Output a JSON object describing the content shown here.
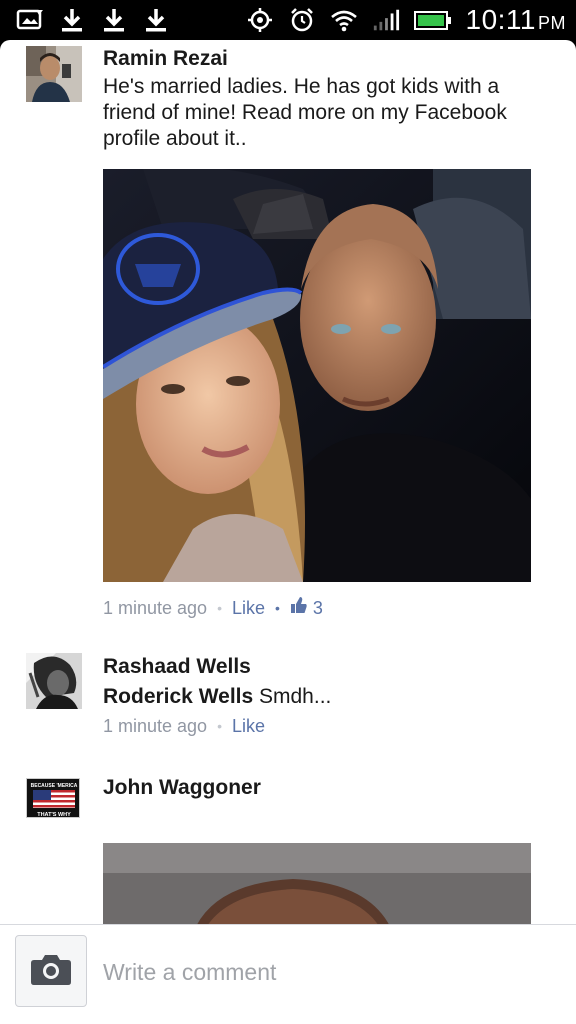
{
  "status_bar": {
    "time": "10:11",
    "ampm": "PM",
    "left_icons": [
      "photo-sync-icon",
      "download-icon",
      "download-icon",
      "download-icon"
    ],
    "right_icons": [
      "gps-icon",
      "alarm-icon",
      "wifi-icon",
      "signal-icon",
      "battery-icon"
    ]
  },
  "comments": [
    {
      "author": "Ramin Rezai",
      "text": "He's married ladies. He has got kids with a friend of mine! Read more on my Facebook profile about it..",
      "time": "1 minute ago",
      "like_label": "Like",
      "like_count": "3"
    },
    {
      "author": "Rashaad Wells",
      "mention": "Roderick Wells",
      "text": " Smdh...",
      "time": "1 minute ago",
      "like_label": "Like"
    },
    {
      "author": "John Waggoner",
      "avatar_text_top": "BECAUSE 'MERICA",
      "avatar_text_bottom": "THAT'S WHY"
    }
  ],
  "composer": {
    "placeholder": "Write a comment",
    "camera_icon": "camera-icon"
  },
  "colors": {
    "link": "#5b74a8",
    "meta": "#9197a3",
    "text": "#1a1a1a"
  }
}
